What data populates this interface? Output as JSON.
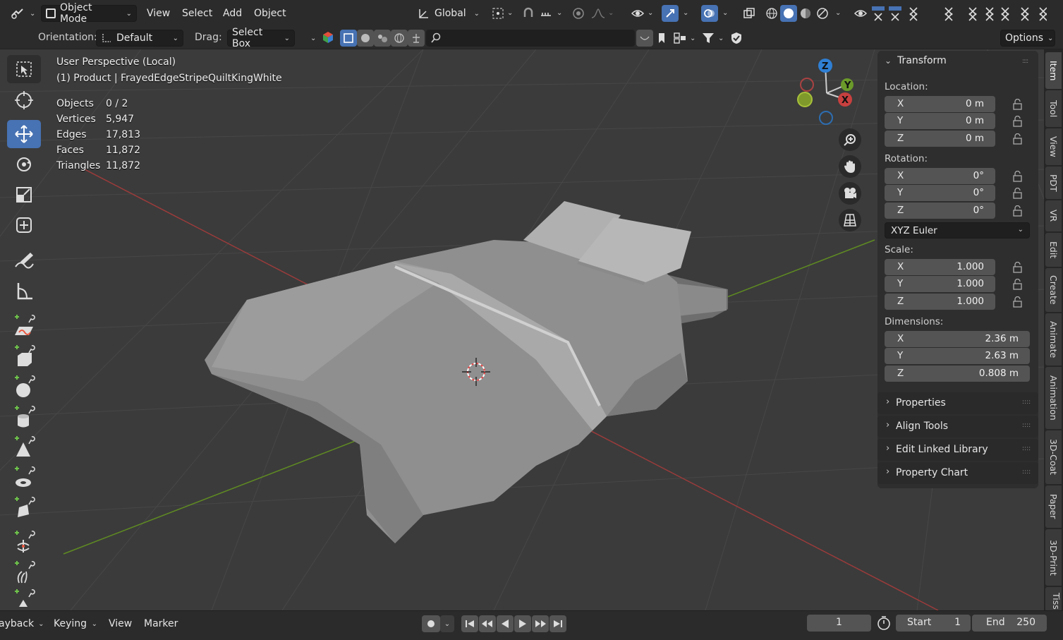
{
  "header": {
    "mode": "Object Mode",
    "menus": [
      "View",
      "Select",
      "Add",
      "Object"
    ],
    "orientation_dropdown": "Global",
    "icons": [
      "editor-type-icon",
      "transform-pivot-icon",
      "snap-icon",
      "proportional-edit-icon",
      "visibility-icon",
      "gizmo-icon",
      "overlay-icon",
      "xray-icon",
      "shading-wireframe-icon",
      "shading-solid-icon",
      "shading-material-icon",
      "shading-rendered-icon"
    ]
  },
  "toolbar2": {
    "orientation_label": "Orientation:",
    "orientation_value": "Default",
    "drag_label": "Drag:",
    "drag_value": "Select Box",
    "options_label": "Options",
    "search_placeholder": ""
  },
  "viewport": {
    "view_name": "User Perspective (Local)",
    "object_name": "(1) Product | FrayedEdgeStripeQuiltKingWhite",
    "stats": [
      {
        "label": "Objects",
        "value": "0 / 2"
      },
      {
        "label": "Vertices",
        "value": "5,947"
      },
      {
        "label": "Edges",
        "value": "17,813"
      },
      {
        "label": "Faces",
        "value": "11,872"
      },
      {
        "label": "Triangles",
        "value": "11,872"
      }
    ],
    "gizmo": {
      "x": "X",
      "y": "Y",
      "z": "Z"
    },
    "colors": {
      "x_axis": "#c8403f",
      "y_axis": "#6b9a2a",
      "z_axis": "#2f7fd4",
      "active_tool": "#4772b3"
    }
  },
  "sidebar": {
    "transform_title": "Transform",
    "location_label": "Location:",
    "location": [
      {
        "axis": "X",
        "value": "0 m"
      },
      {
        "axis": "Y",
        "value": "0 m"
      },
      {
        "axis": "Z",
        "value": "0 m"
      }
    ],
    "rotation_label": "Rotation:",
    "rotation": [
      {
        "axis": "X",
        "value": "0°"
      },
      {
        "axis": "Y",
        "value": "0°"
      },
      {
        "axis": "Z",
        "value": "0°"
      }
    ],
    "rotation_mode": "XYZ Euler",
    "scale_label": "Scale:",
    "scale": [
      {
        "axis": "X",
        "value": "1.000"
      },
      {
        "axis": "Y",
        "value": "1.000"
      },
      {
        "axis": "Z",
        "value": "1.000"
      }
    ],
    "dimensions_label": "Dimensions:",
    "dimensions": [
      {
        "axis": "X",
        "value": "2.36 m"
      },
      {
        "axis": "Y",
        "value": "2.63 m"
      },
      {
        "axis": "Z",
        "value": "0.808 m"
      }
    ],
    "panels": [
      "Properties",
      "Align Tools",
      "Edit Linked Library",
      "Property Chart"
    ],
    "tabs": [
      "Item",
      "Tool",
      "View",
      "PDT",
      "VR",
      "Edit",
      "Create",
      "Animate",
      "Animation",
      "3D-Coat",
      "Paper",
      "3D-Print",
      "Tiss"
    ]
  },
  "timeline": {
    "playback": "ayback",
    "keying": "Keying",
    "view": "View",
    "marker": "Marker",
    "current_frame": "1",
    "start_label": "Start",
    "start": "1",
    "end_label": "End",
    "end": "250"
  }
}
